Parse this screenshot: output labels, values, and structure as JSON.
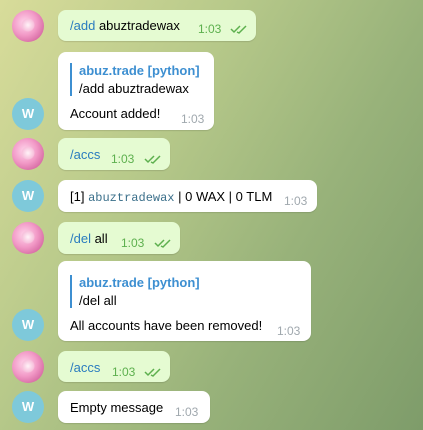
{
  "messages": [
    {
      "sender": "user",
      "command": "/add",
      "text": "abuztradewax",
      "time": "1:03"
    },
    {
      "sender": "bot",
      "avatar": "W",
      "reply_name": "abuz.trade [python]",
      "reply_text": "/add abuztradewax",
      "text": "Account added!",
      "time": "1:03"
    },
    {
      "sender": "user",
      "command": "/accs",
      "text": "",
      "time": "1:03"
    },
    {
      "sender": "bot",
      "avatar": "W",
      "prefix": "[1] ",
      "mono": "abuztradewax",
      "suffix": " | 0 WAX | 0 TLM",
      "time": "1:03"
    },
    {
      "sender": "user",
      "command": "/del",
      "text": " all",
      "time": "1:03"
    },
    {
      "sender": "bot",
      "avatar": "W",
      "reply_name": "abuz.trade [python]",
      "reply_text": "/del all",
      "text": "All accounts have been removed!",
      "time": "1:03"
    },
    {
      "sender": "user",
      "command": "/accs",
      "text": "",
      "time": "1:03"
    },
    {
      "sender": "bot",
      "avatar": "W",
      "text": "Empty message",
      "time": "1:03"
    }
  ],
  "colors": {
    "outgoing": "#e5fbd2",
    "incoming": "#ffffff",
    "link": "#2a7cbf",
    "reply_accent": "#3d8fd1",
    "read_check": "#5db04e"
  }
}
